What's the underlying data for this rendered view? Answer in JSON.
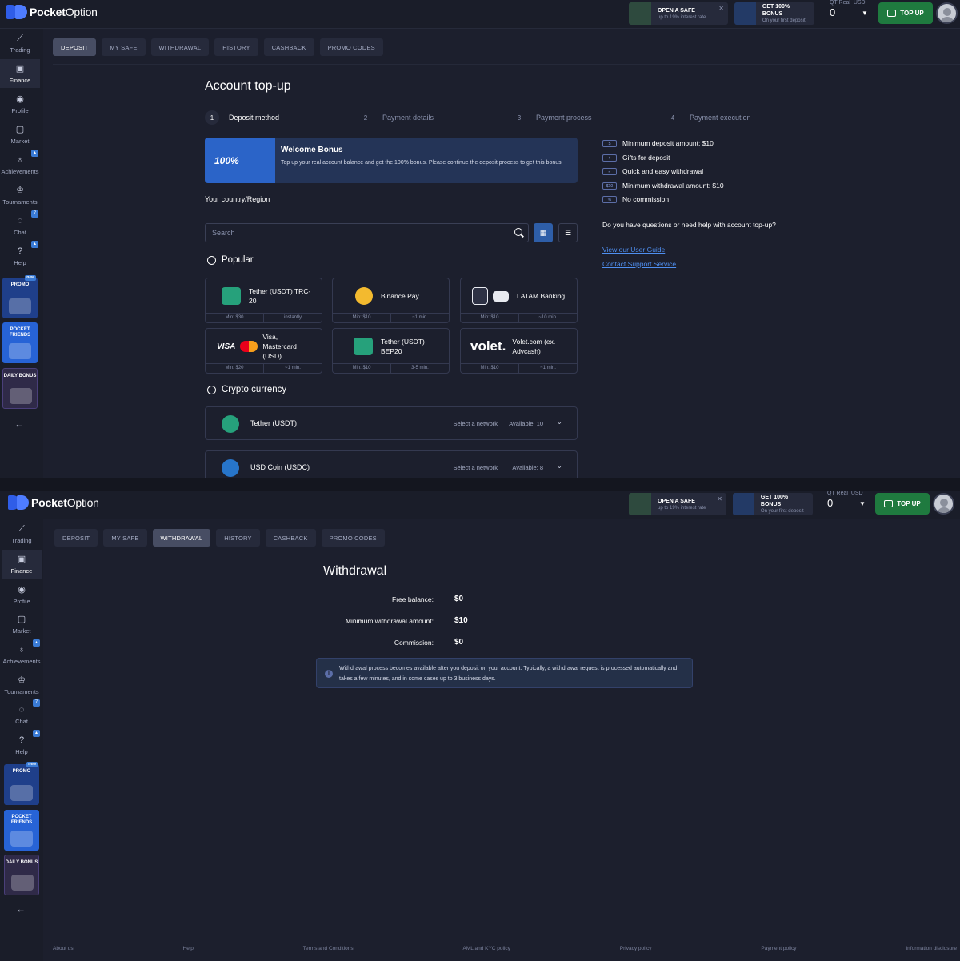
{
  "brand": {
    "name_bold": "Pocket",
    "name_light": "Option"
  },
  "header": {
    "safe_promo": {
      "title": "OPEN A SAFE",
      "subtitle": "up to 19% interest rate"
    },
    "bonus_promo": {
      "title": "GET 100% BONUS",
      "subtitle": "On your first deposit"
    },
    "account": {
      "type_label": "QT Real",
      "currency": "USD",
      "balance": "0"
    },
    "topup_label": "TOP UP"
  },
  "sidebar": {
    "items": [
      {
        "label": "Trading",
        "icon": "trading-chart-icon"
      },
      {
        "label": "Finance",
        "icon": "wallet-icon"
      },
      {
        "label": "Profile",
        "icon": "profile-icon"
      },
      {
        "label": "Market",
        "icon": "market-icon"
      },
      {
        "label": "Achievements",
        "icon": "achievements-icon"
      },
      {
        "label": "Tournaments",
        "icon": "trophy-icon"
      },
      {
        "label": "Chat",
        "icon": "chat-icon",
        "badge": "7"
      },
      {
        "label": "Help",
        "icon": "help-icon"
      }
    ],
    "cards": {
      "promo": "PROMO",
      "promo_badge": "new",
      "friends": "POCKET FRIENDS",
      "daily": "DAILY BONUS"
    }
  },
  "tabs": [
    "DEPOSIT",
    "MY SAFE",
    "WITHDRAWAL",
    "HISTORY",
    "CASHBACK",
    "PROMO CODES"
  ],
  "deposit": {
    "title": "Account top-up",
    "steps": [
      {
        "n": "1",
        "label": "Deposit method"
      },
      {
        "n": "2",
        "label": "Payment details"
      },
      {
        "n": "3",
        "label": "Payment process"
      },
      {
        "n": "4",
        "label": "Payment execution"
      }
    ],
    "bonus": {
      "badge": "100%",
      "title": "Welcome Bonus",
      "text": "Top up your real account balance and get the 100% bonus. Please continue the deposit process to get this bonus."
    },
    "country_label": "Your country/Region",
    "search_placeholder": "Search",
    "popular_title": "Popular",
    "methods": [
      {
        "name": "Tether (USDT) TRC-20",
        "min": "Min: $30",
        "time": "instantly",
        "color": "#26a17b"
      },
      {
        "name": "Binance Pay",
        "min": "Min: $10",
        "time": "~1 min.",
        "color": "#f3ba2f"
      },
      {
        "name": "LATAM Banking",
        "min": "Min: $10",
        "time": "~10 min.",
        "color": "#e8eaf0"
      },
      {
        "name": "Visa, Mastercard (USD)",
        "logo_text": "VISA",
        "min": "Min: $20",
        "time": "~1 min.",
        "color": "#eb001b"
      },
      {
        "name": "Tether (USDT) BEP20",
        "min": "Min: $10",
        "time": "3-5 min.",
        "color": "#26a17b"
      },
      {
        "name": "Volet.com (ex. Advcash)",
        "logo_text": "volet.",
        "min": "Min: $10",
        "time": "~1 min.",
        "color": "#ffffff"
      }
    ],
    "crypto_title": "Crypto currency",
    "crypto": [
      {
        "name": "Tether (USDT)",
        "network": "Select a network",
        "available": "Available: 10",
        "color": "#26a17b"
      },
      {
        "name": "USD Coin (USDC)",
        "network": "Select a network",
        "available": "Available: 8",
        "color": "#2775ca"
      }
    ],
    "features": [
      {
        "icon": "$",
        "text": "Minimum deposit amount: $10"
      },
      {
        "icon": "gift",
        "text": "Gifts for deposit"
      },
      {
        "icon": "✓",
        "text": "Quick and easy withdrawal"
      },
      {
        "icon": "$10",
        "text": "Minimum withdrawal amount: $10"
      },
      {
        "icon": "%",
        "text": "No commission"
      }
    ],
    "help_question": "Do you have questions or need help with account top-up?",
    "guide_link": "View our User Guide",
    "support_link": "Contact Support Service"
  },
  "withdrawal": {
    "title": "Withdrawal",
    "rows": [
      {
        "label": "Free balance:",
        "value": "$0"
      },
      {
        "label": "Minimum withdrawal amount:",
        "value": "$10"
      },
      {
        "label": "Commission:",
        "value": "$0"
      }
    ],
    "note": "Withdrawal process becomes available after you deposit on your account. Typically, a withdrawal request is processed automatically and takes a few minutes, and in some cases up to 3 business days."
  },
  "footer": [
    "About us",
    "Help",
    "Terms and Conditions",
    "AML and KYC policy",
    "Privacy policy",
    "Payment policy",
    "Information disclosure"
  ]
}
